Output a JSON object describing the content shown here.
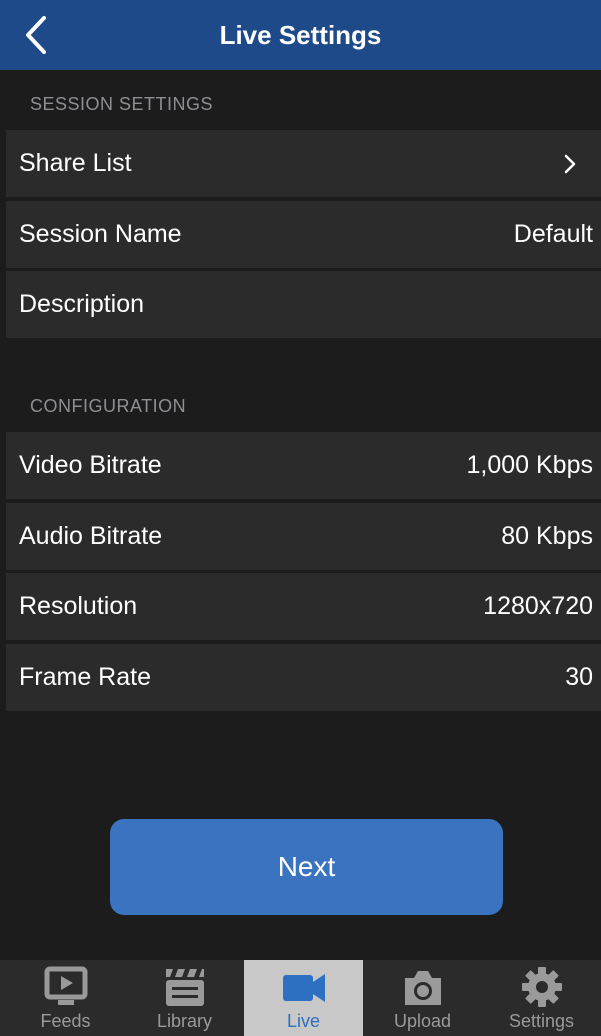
{
  "header": {
    "title": "Live Settings",
    "back_icon": "chevron-left-icon"
  },
  "sections": {
    "session": {
      "title": "SESSION SETTINGS",
      "rows": [
        {
          "label": "Share List",
          "value": "",
          "accessory": "chevron-right-icon"
        },
        {
          "label": "Session Name",
          "value": "Default"
        },
        {
          "label": "Description",
          "value": ""
        }
      ]
    },
    "configuration": {
      "title": "CONFIGURATION",
      "rows": [
        {
          "label": "Video Bitrate",
          "value": "1,000 Kbps"
        },
        {
          "label": "Audio Bitrate",
          "value": "80 Kbps"
        },
        {
          "label": "Resolution",
          "value": "1280x720"
        },
        {
          "label": "Frame Rate",
          "value": "30"
        }
      ]
    }
  },
  "next_button": {
    "label": "Next"
  },
  "tabs": [
    {
      "label": "Feeds",
      "icon": "tv-play-icon",
      "active": false
    },
    {
      "label": "Library",
      "icon": "clapperboard-icon",
      "active": false
    },
    {
      "label": "Live",
      "icon": "video-camera-icon",
      "active": true
    },
    {
      "label": "Upload",
      "icon": "camera-icon",
      "active": false
    },
    {
      "label": "Settings",
      "icon": "gear-icon",
      "active": false
    }
  ],
  "colors": {
    "nav_bar": "#1e4a8a",
    "background": "#1c1c1c",
    "row": "#2b2b2b",
    "section_header_text": "#8e8e93",
    "button": "#3a74c0",
    "tab_active_bg": "#c8c8c8",
    "tab_active_fg": "#2d6fc1",
    "tab_inactive": "#9a9a9a"
  }
}
